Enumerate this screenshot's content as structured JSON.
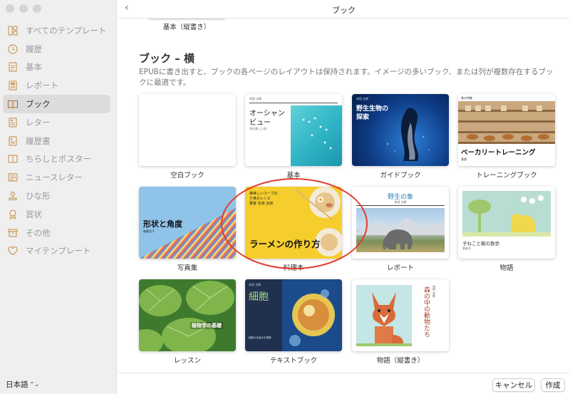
{
  "window": {
    "title": "ブック"
  },
  "sidebar": {
    "items": [
      {
        "label": "すべてのテンプレート",
        "icon": "template-grid-icon"
      },
      {
        "label": "履歴",
        "icon": "clock-icon"
      },
      {
        "label": "基本",
        "icon": "document-icon"
      },
      {
        "label": "レポート",
        "icon": "report-icon"
      },
      {
        "label": "ブック",
        "icon": "book-icon"
      },
      {
        "label": "レター",
        "icon": "letter-icon"
      },
      {
        "label": "履歴書",
        "icon": "resume-icon"
      },
      {
        "label": "ちらしとポスター",
        "icon": "poster-icon"
      },
      {
        "label": "ニュースレター",
        "icon": "newsletter-icon"
      },
      {
        "label": "ひな形",
        "icon": "stamp-icon"
      },
      {
        "label": "賞状",
        "icon": "certificate-icon"
      },
      {
        "label": "その他",
        "icon": "box-icon"
      },
      {
        "label": "マイテンプレート",
        "icon": "heart-icon"
      }
    ],
    "language": "日本語"
  },
  "previous_section": {
    "label": "基本（縦書き）"
  },
  "section": {
    "title": "ブック – 横",
    "description": "EPUBに書き出すと、ブックの各ページのレイアウトは保持されます。イメージの多いブック、または列が複数存在するブックに最適です。"
  },
  "templates": [
    {
      "label": "空白ブック"
    },
    {
      "label": "基本",
      "cover_title_1": "オーシャン",
      "cover_title_2": "ビュー",
      "cover_author": "本田 太郎",
      "cover_sub": "海の美しい島"
    },
    {
      "label": "ガイドブック",
      "cover_author": "本田 太郎",
      "cover_title_1": "野生生物の",
      "cover_title_2": "探索"
    },
    {
      "label": "トレーニングブック",
      "cover_author": "食の特集",
      "cover_title": "ベーカリートレーニング",
      "cover_sub": "基礎"
    },
    {
      "label": "写真集",
      "cover_title": "形状と角度",
      "cover_author": "編集花子"
    },
    {
      "label": "料理本",
      "cover_line_1": "美味しいスープの",
      "cover_line_2": "夕食のレシピ",
      "cover_author": "著者 永田 太郎",
      "cover_title": "ラーメンの作り方"
    },
    {
      "label": "レポート",
      "cover_title": "野生の象",
      "cover_author": "本田 太郎"
    },
    {
      "label": "物語",
      "cover_title": "子ねこと朝の散歩",
      "cover_author": "著者名"
    },
    {
      "label": "レッスン",
      "cover_title": "植物学の基礎"
    },
    {
      "label": "テキストブック",
      "cover_author": "本田 太郎",
      "cover_title": "細胞",
      "cover_sub": "細胞の仕組みを理解"
    },
    {
      "label": "物語（縦書き）",
      "cover_author": "本田 次郎",
      "cover_title": "森の中の動物たち"
    }
  ],
  "buttons": {
    "cancel": "キャンセル",
    "create": "作成"
  },
  "colors": {
    "selection": "#e33b2e",
    "sidebar_bg": "#f0efef",
    "active_item": "#dcdcdc"
  }
}
